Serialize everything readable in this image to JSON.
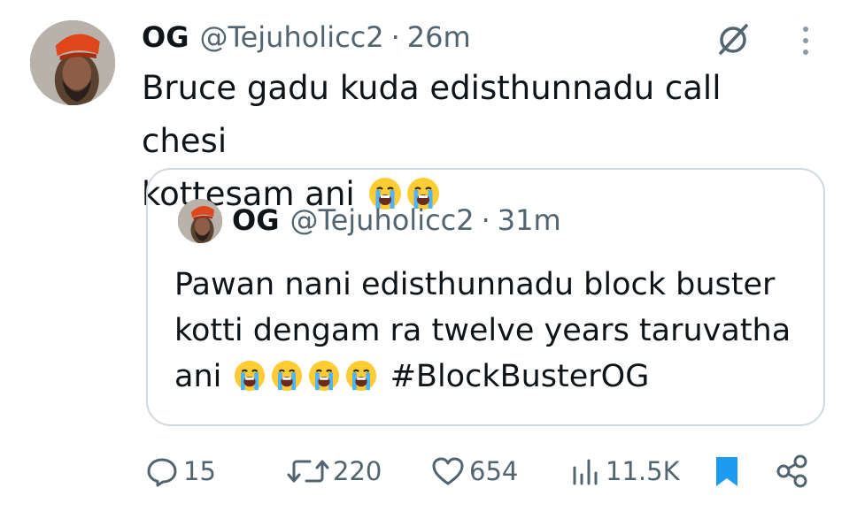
{
  "tweet": {
    "author_name": "OG",
    "handle": "@Tejuholicc2",
    "separator": "·",
    "time": "26m",
    "text": "Bruce gadu kuda edisthunnadu call chesi\nkottesam ani ",
    "text_emojis": [
      "loudly-crying-face",
      "loudly-crying-face"
    ]
  },
  "quoted": {
    "author_name": "OG",
    "handle": "@Tejuholicc2",
    "separator": "·",
    "time": "31m",
    "text": "Pawan nani edisthunnadu block buster kotti dengam ra twelve years taruvatha ani ",
    "text_emojis": [
      "loudly-crying-face",
      "loudly-crying-face",
      "loudly-crying-face",
      "loudly-crying-face"
    ],
    "hashtag": " #BlockBusterOG"
  },
  "actions": {
    "replies": "15",
    "retweets": "220",
    "likes": "654",
    "views": "11.5K"
  },
  "icons": {
    "grok": "grok-icon",
    "more": "more-vertical-icon",
    "reply": "reply-icon",
    "retweet": "retweet-icon",
    "like": "heart-icon",
    "views": "views-icon",
    "bookmark": "bookmark-icon",
    "share": "share-icon"
  },
  "colors": {
    "text": "#0f1419",
    "secondary": "#536471",
    "bookmark": "#1d9bf0",
    "border": "#cfd9de"
  }
}
